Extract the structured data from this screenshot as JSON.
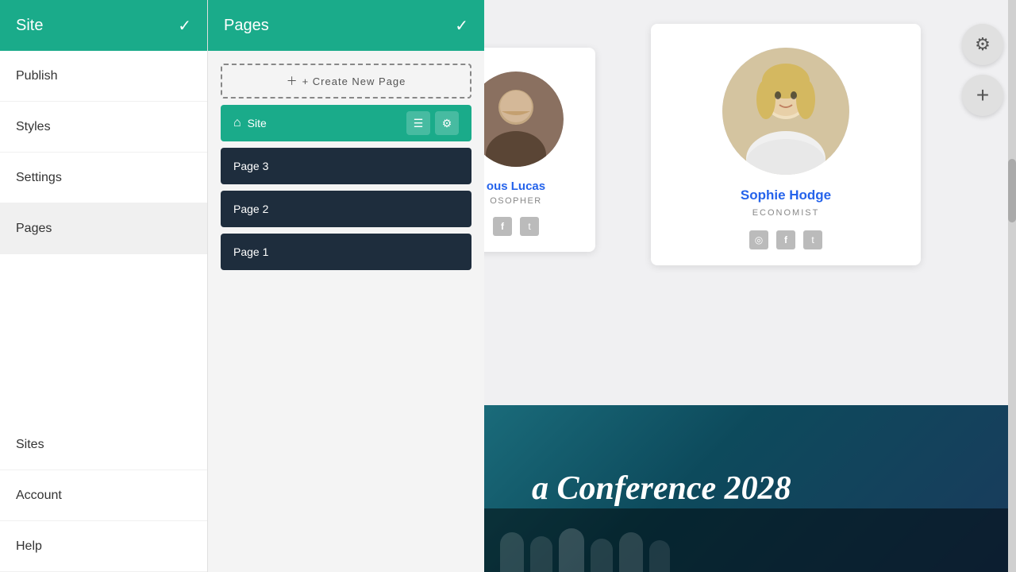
{
  "sidebar": {
    "header": {
      "title": "Site",
      "check_icon": "✓"
    },
    "items": [
      {
        "id": "publish",
        "label": "Publish"
      },
      {
        "id": "styles",
        "label": "Styles"
      },
      {
        "id": "settings",
        "label": "Settings"
      },
      {
        "id": "pages",
        "label": "Pages",
        "active": true
      },
      {
        "id": "sites",
        "label": "Sites"
      },
      {
        "id": "account",
        "label": "Account"
      },
      {
        "id": "help",
        "label": "Help"
      }
    ]
  },
  "pages_panel": {
    "header": {
      "title": "Pages",
      "check_icon": "✓"
    },
    "create_button_label": "+ Create New Page",
    "pages": [
      {
        "id": "site",
        "label": "Site",
        "is_site": true
      },
      {
        "id": "page3",
        "label": "Page 3"
      },
      {
        "id": "page2",
        "label": "Page 2"
      },
      {
        "id": "page1",
        "label": "Page 1"
      }
    ]
  },
  "main_content": {
    "persons": [
      {
        "id": "lucas",
        "name": "ous Lucas",
        "full_name": "Marcus Lucas",
        "title": "OSOPHER",
        "full_title": "PHILOSOPHER",
        "social": [
          "facebook",
          "twitter"
        ]
      },
      {
        "id": "sophie",
        "name": "Sophie Hodge",
        "title": "ECONOMIST",
        "social": [
          "instagram",
          "facebook",
          "twitter"
        ]
      }
    ],
    "conference": {
      "title": "a Conference 2028",
      "full_title": "a Conference 2028"
    },
    "fab_buttons": [
      {
        "id": "settings",
        "icon": "⚙"
      },
      {
        "id": "add",
        "icon": "+"
      }
    ]
  },
  "icons": {
    "check": "✓",
    "plus": "+",
    "home": "⌂",
    "layers": "≡",
    "gear": "⚙",
    "facebook": "f",
    "twitter": "t",
    "instagram": "◎"
  }
}
